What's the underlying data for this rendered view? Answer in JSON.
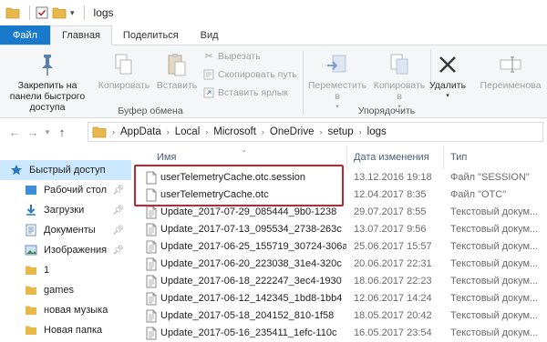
{
  "window": {
    "title": "logs"
  },
  "ribbon_tabs": [
    {
      "label": "Файл"
    },
    {
      "label": "Главная"
    },
    {
      "label": "Поделиться"
    },
    {
      "label": "Вид"
    }
  ],
  "ribbon": {
    "clipboard": {
      "pin_quick_access": "Закрепить на панели быстрого доступа",
      "copy": "Копировать",
      "paste": "Вставить",
      "cut": "Вырезать",
      "copy_path": "Скопировать путь",
      "paste_shortcut": "Вставить ярлык",
      "group_label": "Буфер обмена"
    },
    "organize": {
      "move_to": "Переместить в",
      "copy_to": "Копировать в",
      "delete": "Удалить",
      "rename": "Переименова",
      "group_label": "Упорядочить"
    }
  },
  "address": {
    "crumbs": [
      "AppData",
      "Local",
      "Microsoft",
      "OneDrive",
      "setup",
      "logs"
    ]
  },
  "navpane": {
    "items": [
      {
        "label": "Быстрый доступ",
        "icon": "star-icon",
        "pinned": false,
        "selected": true
      },
      {
        "label": "Рабочий стол",
        "icon": "desktop-folder-icon",
        "pinned": true
      },
      {
        "label": "Загрузки",
        "icon": "download-icon",
        "pinned": true
      },
      {
        "label": "Документы",
        "icon": "documents-icon",
        "pinned": true
      },
      {
        "label": "Изображения",
        "icon": "pictures-icon",
        "pinned": true
      },
      {
        "label": "1",
        "icon": "folder-icon",
        "pinned": false
      },
      {
        "label": "games",
        "icon": "folder-icon",
        "pinned": false
      },
      {
        "label": "новая музыка",
        "icon": "folder-icon",
        "pinned": false
      },
      {
        "label": "Новая папка",
        "icon": "folder-icon",
        "pinned": false
      }
    ]
  },
  "filelist": {
    "columns": {
      "name": "Имя",
      "date": "Дата изменения",
      "type": "Тип"
    },
    "rows": [
      {
        "name": "userTelemetryCache.otc.session",
        "date": "13.12.2016 19:18",
        "type": "Файл \"SESSION\""
      },
      {
        "name": "userTelemetryCache.otc",
        "date": "12.04.2017 8:35",
        "type": "Файл \"OTC\""
      },
      {
        "name": "Update_2017-07-29_085444_9b0-1238",
        "date": "29.07.2017 8:55",
        "type": "Текстовый докум..."
      },
      {
        "name": "Update_2017-07-13_095534_2738-263c",
        "date": "13.07.2017 9:56",
        "type": "Текстовый докум..."
      },
      {
        "name": "Update_2017-06-25_155719_30724-306ac",
        "date": "25.06.2017 15:57",
        "type": "Текстовый докум..."
      },
      {
        "name": "Update_2017-06-20_223038_31e4-320c",
        "date": "20.06.2017 22:31",
        "type": "Текстовый докум..."
      },
      {
        "name": "Update_2017-06-18_222247_3ec4-1930",
        "date": "18.06.2017 22:23",
        "type": "Текстовый докум..."
      },
      {
        "name": "Update_2017-06-12_142345_1bd8-1bb4",
        "date": "12.06.2017 14:24",
        "type": "Текстовый докум..."
      },
      {
        "name": "Update_2017-05-18_204152_810-1f58",
        "date": "18.05.2017 20:42",
        "type": "Текстовый докум..."
      },
      {
        "name": "Update_2017-05-16_235411_1efc-110c",
        "date": "16.05.2017 23:54",
        "type": "Текстовый докум..."
      }
    ]
  },
  "colors": {
    "file_tab": "#1979ca",
    "folder": "#e8b84a",
    "selection": "#cce8ff",
    "highlight": "#c0272d",
    "header_text": "#4c607a"
  }
}
